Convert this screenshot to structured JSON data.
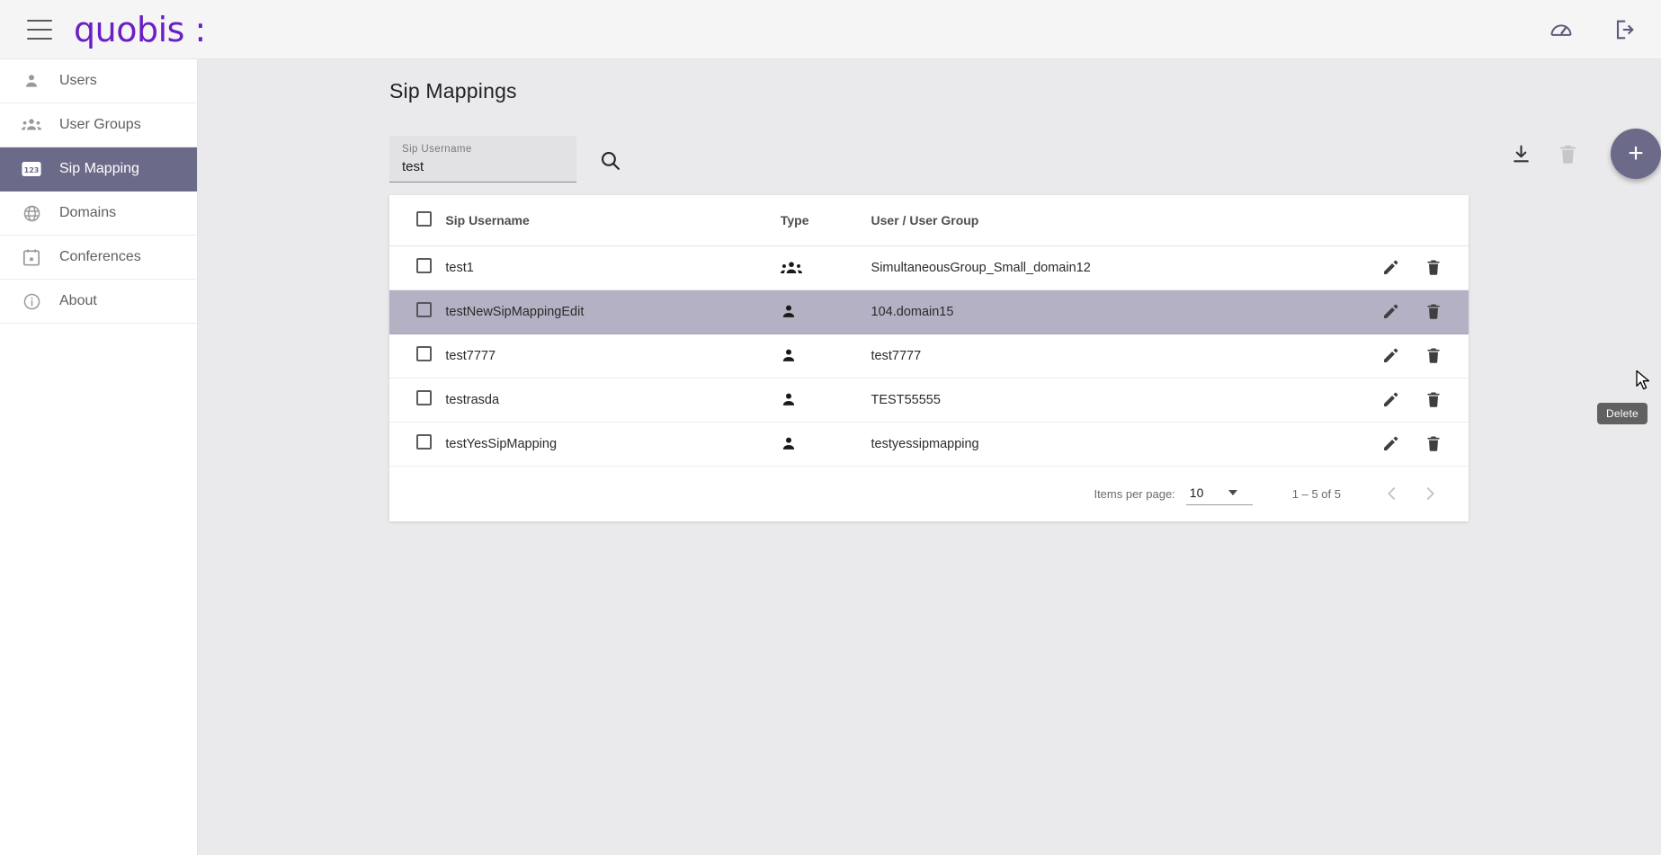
{
  "header": {
    "brand": "quobis :",
    "menu_icon": "hamburger-icon",
    "actions": [
      {
        "name": "dashboard-icon",
        "title": "Dashboard"
      },
      {
        "name": "logout-icon",
        "title": "Logout"
      }
    ]
  },
  "sidebar": {
    "items": [
      {
        "label": "Users",
        "icon": "person-icon",
        "active": false
      },
      {
        "label": "User Groups",
        "icon": "group-icon",
        "active": false
      },
      {
        "label": "Sip Mapping",
        "icon": "123-icon",
        "active": true
      },
      {
        "label": "Domains",
        "icon": "globe-icon",
        "active": false
      },
      {
        "label": "Conferences",
        "icon": "calendar-icon",
        "active": false
      },
      {
        "label": "About",
        "icon": "info-icon",
        "active": false
      }
    ]
  },
  "main": {
    "title": "Sip Mappings",
    "search": {
      "label": "Sip Username",
      "value": "test",
      "placeholder": "",
      "search_icon": "search-icon"
    },
    "toolbar": {
      "download_label": "Download",
      "delete_label": "Delete",
      "add_label": "+"
    },
    "table": {
      "columns": [
        "",
        "Sip Username",
        "Type",
        "User / User Group",
        ""
      ],
      "rows": [
        {
          "sip_username": "test1",
          "type": "group",
          "user": "SimultaneousGroup_Small_domain12",
          "selected": false
        },
        {
          "sip_username": "testNewSipMappingEdit",
          "type": "user",
          "user": "104.domain15",
          "selected": true
        },
        {
          "sip_username": "test7777",
          "type": "user",
          "user": "test7777",
          "selected": false
        },
        {
          "sip_username": "testrasda",
          "type": "user",
          "user": "TEST55555",
          "selected": false
        },
        {
          "sip_username": "testYesSipMapping",
          "type": "user",
          "user": "testyessipmapping",
          "selected": false
        }
      ],
      "row_actions": {
        "edit_label": "Edit",
        "delete_label": "Delete"
      }
    },
    "tooltip": {
      "text": "Delete"
    },
    "paginator": {
      "items_per_page_label": "Items per page:",
      "items_per_page_value": "10",
      "range_label": "1 – 5 of 5",
      "prev_label": "Previous page",
      "next_label": "Next page"
    }
  },
  "colors": {
    "brand_purple": "#6a1fc4",
    "accent_slate": "#6b6a88",
    "row_selected": "#b4b1c4",
    "content_bg": "#eaeaec",
    "tooltip_bg": "#616161"
  }
}
